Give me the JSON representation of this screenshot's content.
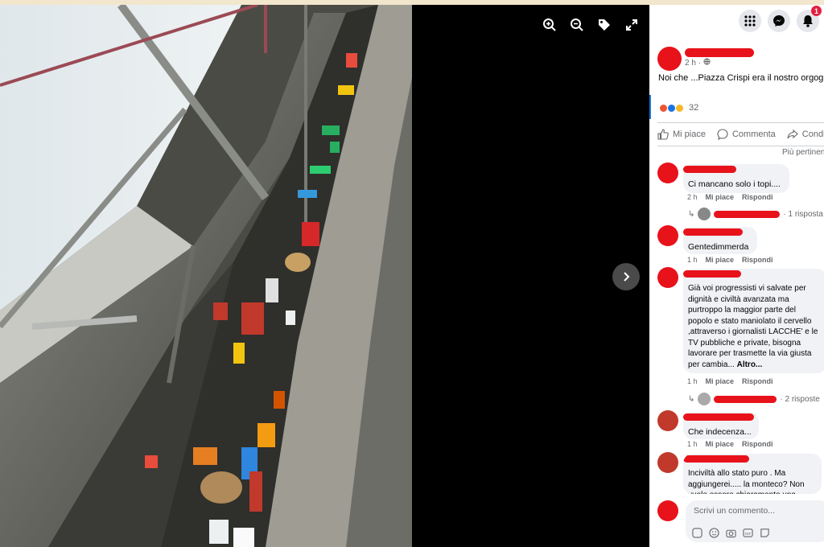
{
  "viewer": {
    "tools": [
      {
        "icon": "zoom-in-icon"
      },
      {
        "icon": "zoom-out-icon"
      },
      {
        "icon": "tag-icon"
      },
      {
        "icon": "fullscreen-icon"
      }
    ],
    "next_icon": "chevron-right-icon"
  },
  "header": {
    "icons": [
      "menu-grid-icon",
      "messenger-icon",
      "notifications-icon"
    ],
    "notification_count": "1"
  },
  "post": {
    "time": "2 h",
    "privacy_icon": "globe-icon",
    "caption": "Noi che ...Piazza Crispi era il nostro orgoglio",
    "reaction_count": "32",
    "actions": {
      "like": "Mi piace",
      "comment": "Commenta",
      "share": "Condividi"
    },
    "sort_label": "Più pertinenti"
  },
  "comments": [
    {
      "text": "Ci mancano solo i topi....",
      "time": "2 h",
      "like": "Mi piace",
      "reply": "Rispondi",
      "replies": "· 1 risposta"
    },
    {
      "text": "Gentedimmerda",
      "time": "1 h",
      "like": "Mi piace",
      "reply": "Rispondi"
    },
    {
      "text": "Già voi progressisti vi salvate per dignità e civiltà avanzata ma purtroppo la maggior parte del popolo e stato maniolato il cervello ,attraverso i giornalisti LACCHE' e le TV pubbliche e private, bisogna lavorare per trasmette la via giusta per cambia...",
      "more": "Altro...",
      "time": "1 h",
      "like": "Mi piace",
      "reply": "Rispondi",
      "replies": "· 2 risposte"
    },
    {
      "text": "Che indecenza...",
      "time": "1 h",
      "like": "Mi piace",
      "reply": "Rispondi"
    },
    {
      "text": "Inciviltà allo stato puro . Ma aggiungerei..... la monteco? Non vuole essere chiaramente una"
    }
  ],
  "composer": {
    "placeholder": "Scrivi un commento...",
    "icons": [
      "sticker-icon",
      "emoji-icon",
      "camera-icon",
      "gif-icon",
      "avatar-sticker-icon"
    ]
  },
  "colors": {
    "accent": "#1b74e4",
    "redaction": "#e8121b",
    "badge": "#e41e3f"
  }
}
